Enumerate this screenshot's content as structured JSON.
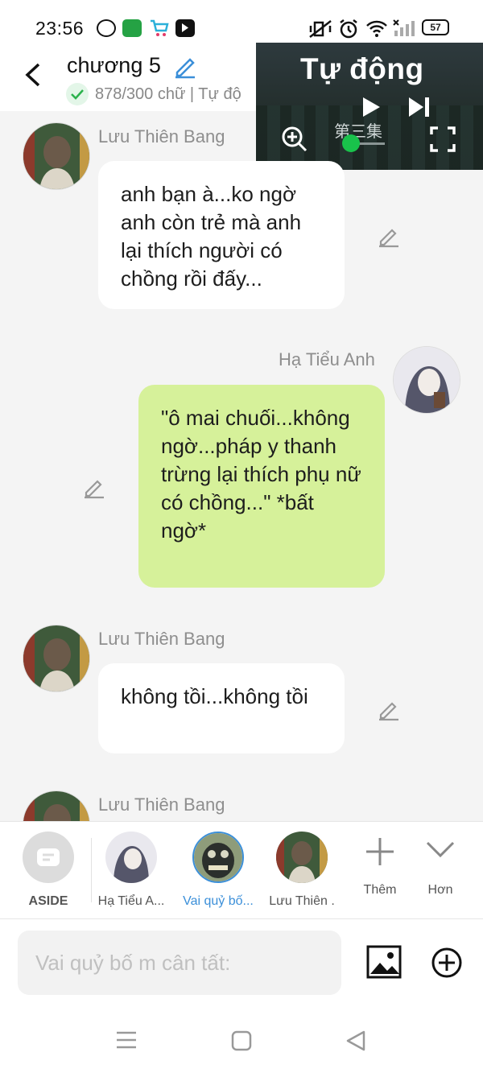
{
  "status_bar": {
    "time": "23:56",
    "battery": "57"
  },
  "header": {
    "title": "chương 5",
    "subtitle": "878/300 chữ | Tự độ"
  },
  "video": {
    "title": "Tự động",
    "episode": "第三集"
  },
  "messages": [
    {
      "speaker": "Lưu Thiên Bang",
      "text": "anh bạn à...ko ngờ anh còn trẻ mà anh lại thích người có chồng rồi đấy...",
      "side": "left"
    },
    {
      "speaker": "Hạ Tiểu Anh",
      "text": "\"ô mai chuối...không ngờ...pháp y thanh trừng lại thích phụ nữ có chồng...\" *bất ngờ*",
      "side": "right"
    },
    {
      "speaker": "Lưu Thiên Bang",
      "text": "không tồi...không tồi",
      "side": "left"
    },
    {
      "speaker": "Lưu Thiên Bang",
      "text": "",
      "side": "left"
    }
  ],
  "characters": [
    {
      "label": "ASIDE"
    },
    {
      "label": "Hạ Tiểu A..."
    },
    {
      "label": "Vai quỷ bố...",
      "selected": true
    },
    {
      "label": "Lưu Thiên ."
    },
    {
      "label": "Thêm"
    },
    {
      "label": "Hơn"
    }
  ],
  "input": {
    "placeholder": "Vai quỷ bố m cân tất:"
  },
  "colors": {
    "accent": "#3b8fd9",
    "green_check": "#2bb24c",
    "right_bubble": "#d6f19a"
  }
}
